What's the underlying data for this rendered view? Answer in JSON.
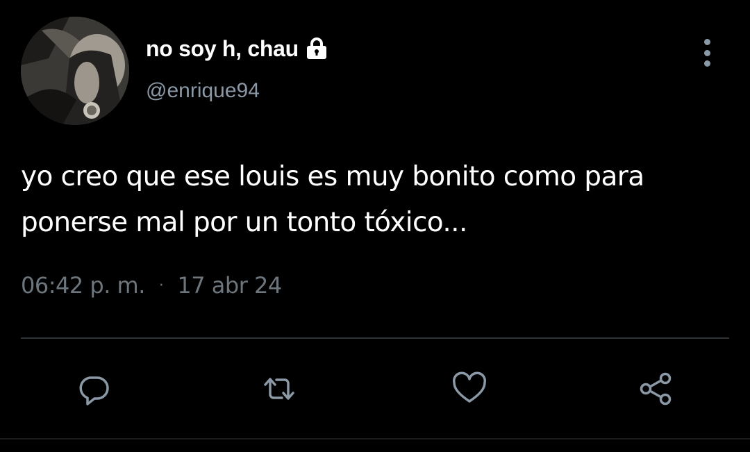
{
  "tweet": {
    "display_name": "no soy h, chau",
    "handle": "@enrique94",
    "text": "yo creo que ese louis es muy bonito como para\nponerse mal por un tonto tóxico...",
    "time": "06:42 p. m.",
    "separator": "·",
    "date": "17 abr 24",
    "protected": true
  },
  "icons": {
    "lock": "lock-icon",
    "more": "more-vertical-icon",
    "reply": "reply-icon",
    "retweet": "retweet-icon",
    "like": "heart-icon",
    "share": "share-icon"
  },
  "colors": {
    "background": "#000000",
    "text_primary": "#ffffff",
    "text_secondary": "#8b98a5",
    "meta": "#6e767d",
    "divider": "#2f3336",
    "icon": "#8b98a5"
  }
}
